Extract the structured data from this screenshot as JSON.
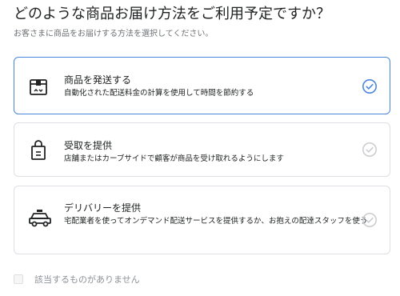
{
  "header": {
    "title": "どのような商品お届け方法をご利用予定ですか？",
    "subtitle": "お客さまに商品をお届けする方法を選択してください。"
  },
  "options": [
    {
      "icon": "shipping-box-icon",
      "label": "商品を発送する",
      "description": "自動化された配送料金の計算を使用して時間を節約する",
      "selected": true
    },
    {
      "icon": "shopping-bag-icon",
      "label": "受取を提供",
      "description": "店舗またはカーブサイドで顧客が商品を受け取れるようにします",
      "selected": false
    },
    {
      "icon": "delivery-car-icon",
      "label": "デリバリーを提供",
      "description": "宅配業者を使ってオンデマンド配送サービスを提供するか、お抱えの配達スタッフを使う",
      "selected": false
    }
  ],
  "none_option": {
    "label": "該当するものがありません",
    "checked": false
  },
  "colors": {
    "accent": "#4a86dc",
    "border": "#dcdfe3",
    "muted_check": "#c9cccf",
    "text": "#202223",
    "subdued": "#6d7175"
  }
}
